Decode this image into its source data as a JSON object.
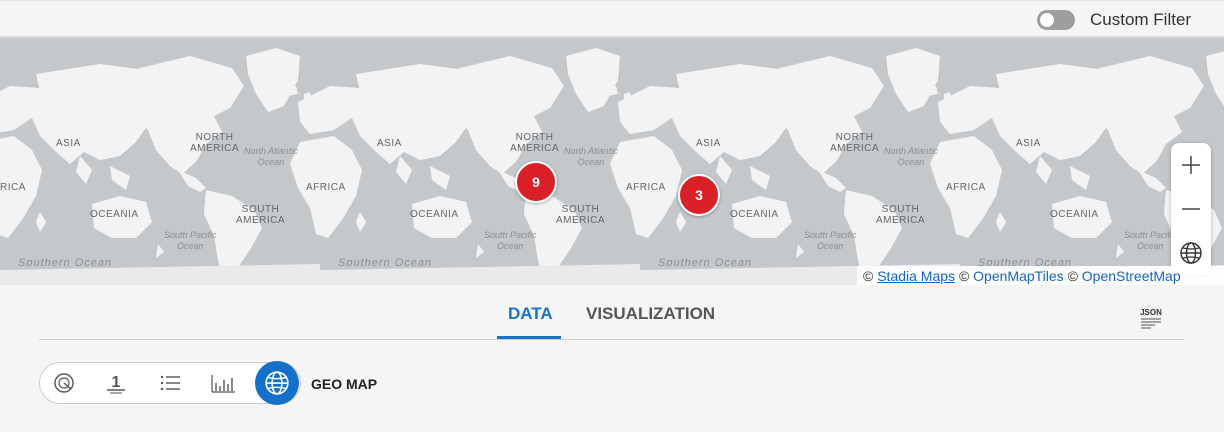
{
  "filter": {
    "label": "Custom Filter",
    "enabled": false
  },
  "map": {
    "labels": {
      "north_america": "NORTH\nAMERICA",
      "south_america": "SOUTH\nAMERICA",
      "africa": "AFRICA",
      "asia": "ASIA",
      "oceania": "OCEANIA",
      "north_atlantic": "North Atlantic\nOcean",
      "south_pacific": "South Pacific\nOcean",
      "southern_ocean": "Southern Ocean",
      "rica": "RICA"
    },
    "clusters": [
      {
        "count": "9"
      },
      {
        "count": "3"
      }
    ],
    "attribution": {
      "copyright": "©",
      "stadia": "Stadia Maps",
      "omt": "OpenMapTiles",
      "osm": "OpenStreetMap"
    },
    "controls": [
      "zoom-in",
      "zoom-out",
      "globe"
    ]
  },
  "tabs": [
    {
      "label": "DATA",
      "active": true
    },
    {
      "label": "VISUALIZATION",
      "active": false
    }
  ],
  "json_button": "JSON",
  "view": {
    "selected_label": "GEO MAP",
    "options": [
      "chart",
      "single-value",
      "list",
      "bar-chart",
      "geo-map"
    ],
    "single_value_glyph": "1"
  },
  "colors": {
    "accent": "#1a73c8",
    "cluster": "#d92027"
  }
}
